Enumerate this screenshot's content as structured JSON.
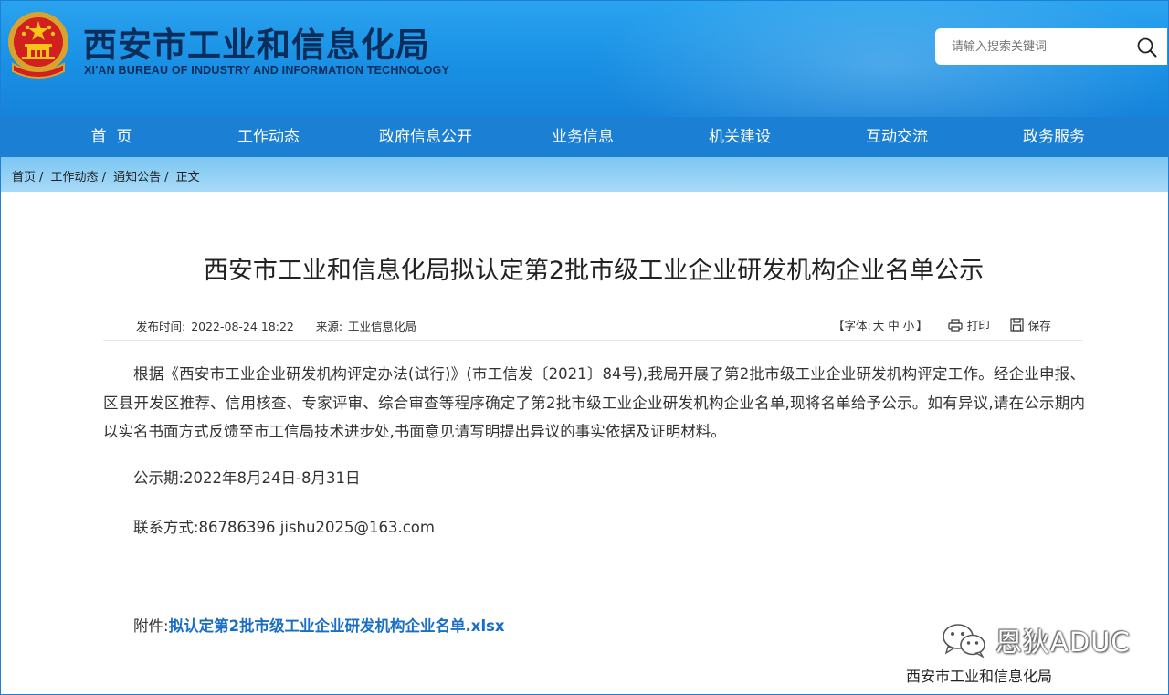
{
  "header": {
    "title": "西安市工业和信息化局",
    "subtitle": "XI'AN BUREAU OF INDUSTRY AND INFORMATION TECHNOLOGY",
    "search_placeholder": "请输入搜索关键词"
  },
  "nav": {
    "items": [
      "首  页",
      "工作动态",
      "政府信息公开",
      "业务信息",
      "机关建设",
      "互动交流",
      "政务服务"
    ]
  },
  "breadcrumb": [
    "首页",
    "工作动态",
    "通知公告",
    "正文"
  ],
  "article": {
    "title": "西安市工业和信息化局拟认定第2批市级工业企业研发机构企业名单公示",
    "publish_label": "发布时间:",
    "publish_time": "2022-08-24 18:22",
    "source_label": "来源:",
    "source": "工业信息化局",
    "font_size_label": "【字体:",
    "font_sizes": [
      "大",
      "中",
      "小"
    ],
    "font_size_close": "】",
    "print_label": "打印",
    "save_label": "保存",
    "body": "根据《西安市工业企业研发机构评定办法(试行)》(市工信发〔2021〕84号),我局开展了第2批市级工业企业研发机构评定工作。经企业申报、区县开发区推荐、信用核查、专家评审、综合审查等程序确定了第2批市级工业企业研发机构企业名单,现将名单给予公示。如有异议,请在公示期内以实名书面方式反馈至市工信局技术进步处,书面意见请写明提出异议的事实依据及证明材料。",
    "period": "公示期:2022年8月24日-8月31日",
    "contact": "联系方式:86786396 jishu2025@163.com",
    "attachment_label": "附件:",
    "attachment_link": "拟认定第2批市级工业企业研发机构企业名单.xlsx",
    "signature": "西安市工业和信息化局"
  },
  "watermark": {
    "text": "恩狄ADUC",
    "icon": "wechat-icon"
  },
  "colors": {
    "header_blue": "#1990e4",
    "nav_blue": "#1b7fd4",
    "title_navy": "#0b2d5c",
    "link_blue": "#1a6fc4"
  }
}
